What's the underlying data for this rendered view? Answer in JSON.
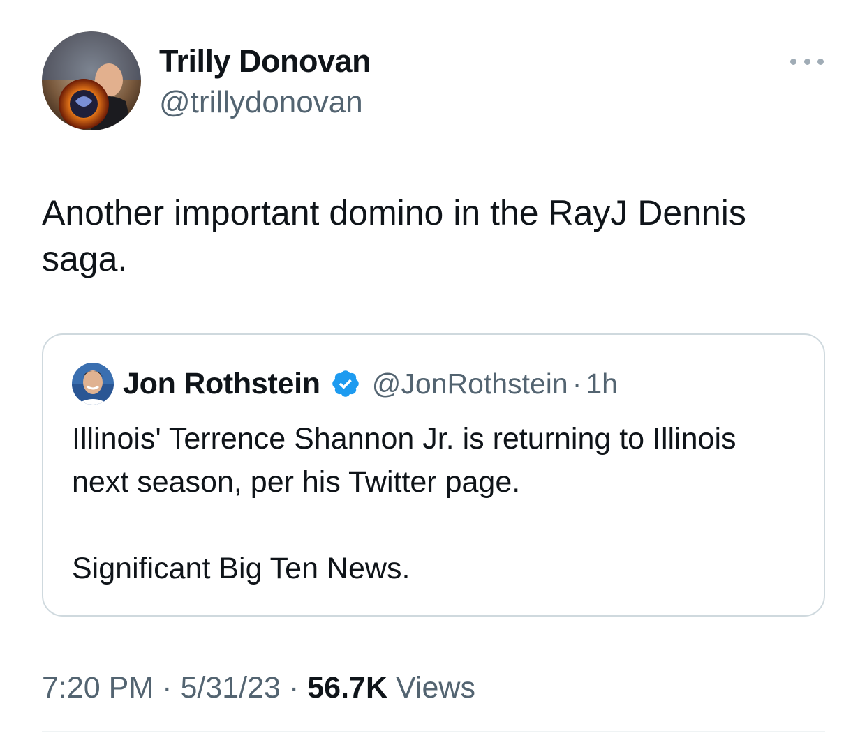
{
  "tweet": {
    "author": {
      "name": "Trilly Donovan",
      "handle": "@trillydonovan"
    },
    "text": "Another important domino in the RayJ Dennis saga.",
    "quoted": {
      "author": {
        "name": "Jon Rothstein",
        "handle": "@JonRothstein",
        "verified": true
      },
      "separator": "·",
      "time": "1h",
      "text": "Illinois' Terrence Shannon Jr. is returning to Illinois next season, per his Twitter page.\n\nSignificant Big Ten News."
    },
    "meta": {
      "time": "7:20 PM",
      "separator": "·",
      "date": "5/31/23",
      "views_count": "56.7K",
      "views_label": "Views"
    }
  },
  "colors": {
    "text_primary": "#0f1419",
    "text_secondary": "#536471",
    "verified_blue": "#1d9bf0",
    "border": "#cfd9de"
  },
  "icons": {
    "more": "more-horizontal-icon",
    "verified": "verified-badge-icon"
  }
}
